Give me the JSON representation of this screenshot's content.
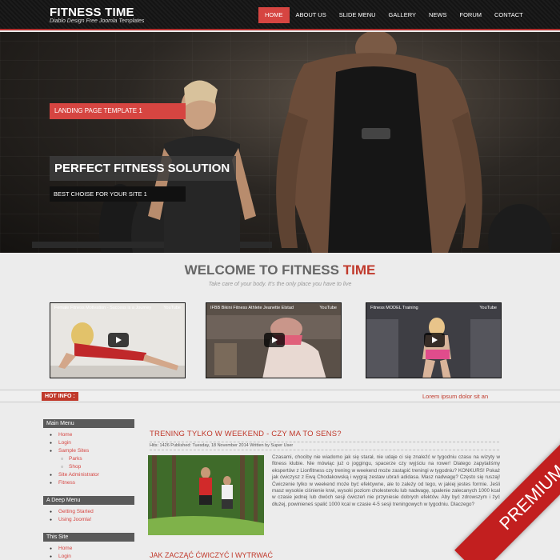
{
  "header": {
    "title": "FITNESS TIME",
    "subtitle": "Diablo Design Free Joomla Templates",
    "nav": [
      "HOME",
      "ABOUT US",
      "SLIDE MENU",
      "GALLERY",
      "NEWS",
      "FORUM",
      "CONTACT"
    ],
    "active_nav": "HOME"
  },
  "hero": {
    "badge": "LANDING PAGE TEMPLATE 1",
    "title": "PERFECT FITNESS SOLUTION 1",
    "subtitle": "BEST CHOISE FOR YOUR SITE 1"
  },
  "welcome": {
    "title_part1": "WELCOME TO FITNESS",
    "title_part2": "TIME",
    "subtitle": "Take care of your body. It's the only place you have to live"
  },
  "videos": [
    {
      "title": "Female Fitness Motivation - Success is a Journey",
      "source": "YouTube"
    },
    {
      "title": "IFBB Bikini Fitness Athlete Jeanette Elstad",
      "source": "YouTube"
    },
    {
      "title": "Fitness MODEL Training",
      "source": "YouTube"
    }
  ],
  "hot": {
    "label": "HOT INFO :",
    "ticker": "Lorem ipsum dolor sit an"
  },
  "sidebar": {
    "main_menu": {
      "title": "Main Menu",
      "items": [
        "Home",
        "Login",
        "Sample Sites",
        "Parks",
        "Shop",
        "Site Administrator",
        "Fitness"
      ]
    },
    "deep_menu": {
      "title": "A Deep Menu",
      "items": [
        "Getting Started",
        "Using Joomla!"
      ]
    },
    "this_site": {
      "title": "This Site",
      "items": [
        "Home",
        "Login"
      ]
    }
  },
  "article": {
    "title": "TRENING TYLKO W WEEKEND - CZY MA TO SENS?",
    "meta": "Hits: 1426 Published: Tuesday, 18 November 2014 Written by Super User",
    "body": "Czasami, chociby nie wiadomo jak się starał, nie udaje ci się znaleźć w tygodniu czasu na wizyty w fitness klubie. Nie mówiąc już o joggingu, spacerze czy wyjściu na rower! Dlatego zapytaliśmy ekspertów z Lionfitness czy trening w weekend może zastąpić treningi w tygodniu? KONKURS! Pokaż jak ćwiczysz z Ewą Chodakowską i wygraj zestaw ubrań adidasa. Masz nadwagę? Często się ruszaj! Ćwiczenie tylko w weekend może być efektywne, ale to zależy od tego, w jakiej jestes formie. Jeśli masz wysokie ciśnienie krwi, wysoki poziom cholesterolu lub nadwagę, spalenie zalecanych 1000 kcal w czasie jednej lub dwóch sesji ćwiczeń nie przyniesie dobrych efektów. Aby być zdrowszym i żyć dłużej, powinieneś spalić 1000 kcal w czasie 4-5 sesji treningowych w tygodniu. Dlaczego?",
    "next_title": "JAK ZACZĄĆ ĆWICZYĆ I WYTRWAĆ"
  },
  "ribbon": "PREMIUM",
  "colors": {
    "accent": "#d64541",
    "header_bg": "#1a1a1a",
    "ribbon": "#c21f1f"
  }
}
